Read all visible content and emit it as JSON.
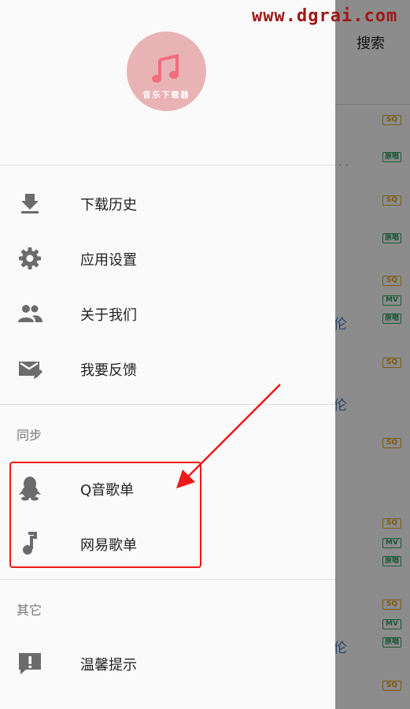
{
  "watermark": "www.dgrai.com",
  "background": {
    "search_label": "搜索",
    "tags": [
      {
        "text": "SQ",
        "kind": "sq"
      },
      {
        "text": "原唱",
        "kind": "yc"
      },
      {
        "text": "SQ",
        "kind": "sq"
      },
      {
        "text": "原唱",
        "kind": "yc"
      },
      {
        "text": "SQ",
        "kind": "sq"
      },
      {
        "text": "MV",
        "kind": "mv"
      },
      {
        "text": "原唱",
        "kind": "yc"
      },
      {
        "text": "SQ",
        "kind": "sq"
      },
      {
        "text": "SQ",
        "kind": "sq"
      },
      {
        "text": "SQ",
        "kind": "sq"
      },
      {
        "text": "MV",
        "kind": "mv"
      },
      {
        "text": "原唱",
        "kind": "yc"
      },
      {
        "text": "SQ",
        "kind": "sq"
      },
      {
        "text": "MV",
        "kind": "mv"
      },
      {
        "text": "原唱",
        "kind": "yc"
      },
      {
        "text": "SQ",
        "kind": "sq"
      }
    ],
    "fragments": [
      "伦",
      "伦",
      "伦"
    ],
    "dots": "..."
  },
  "drawer": {
    "logo_text": "音乐下载器",
    "menu": [
      {
        "label": "下载历史",
        "icon": "download-icon"
      },
      {
        "label": "应用设置",
        "icon": "gear-icon"
      },
      {
        "label": "关于我们",
        "icon": "people-icon"
      },
      {
        "label": "我要反馈",
        "icon": "feedback-mail-icon"
      }
    ],
    "sync": {
      "title": "同步",
      "items": [
        {
          "label": "Q音歌单",
          "icon": "qq-penguin-icon"
        },
        {
          "label": "网易歌单",
          "icon": "music-note-icon"
        }
      ]
    },
    "other": {
      "title": "其它",
      "items": [
        {
          "label": "温馨提示",
          "icon": "alert-bubble-icon"
        }
      ]
    }
  },
  "colors": {
    "highlight": "#f01818",
    "sq_tag": "#e3a326",
    "green_tag": "#2f9e63",
    "logo_bg": "#e9b3b5"
  }
}
